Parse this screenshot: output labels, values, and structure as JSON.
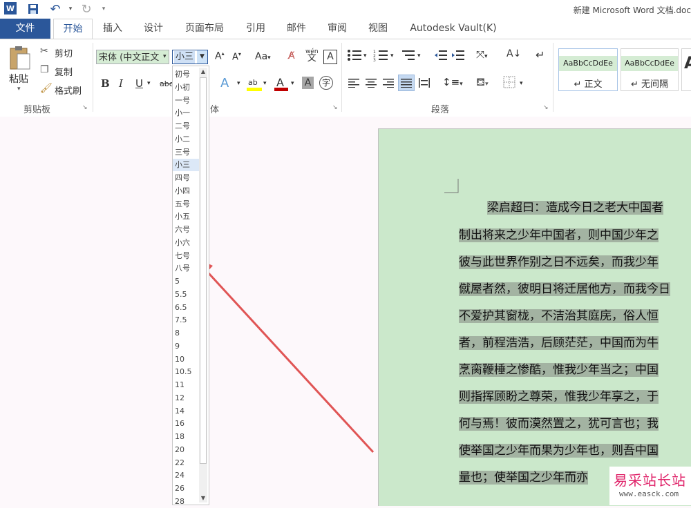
{
  "titlebar": {
    "doc_title": "新建 Microsoft Word 文档.doc"
  },
  "tabs": [
    {
      "label": "文件"
    },
    {
      "label": "开始"
    },
    {
      "label": "插入"
    },
    {
      "label": "设计"
    },
    {
      "label": "页面布局"
    },
    {
      "label": "引用"
    },
    {
      "label": "邮件"
    },
    {
      "label": "审阅"
    },
    {
      "label": "视图"
    },
    {
      "label": "Autodesk Vault(K)"
    }
  ],
  "clipboard": {
    "paste": "粘贴",
    "cut": "剪切",
    "copy": "复制",
    "format_painter": "格式刷",
    "group_label": "剪贴板"
  },
  "font": {
    "name": "宋体 (中文正文",
    "size": "小三",
    "group_label": "体",
    "aa": "Aa",
    "wen": "wén",
    "wen_char": "文",
    "A": "A"
  },
  "paragraph": {
    "group_label": "段落"
  },
  "styles": [
    {
      "sample": "AaBbCcDdEe",
      "name": "↵ 正文"
    },
    {
      "sample": "AaBbCcDdEe",
      "name": "↵ 无间隔"
    },
    {
      "sample": "A",
      "name": ""
    }
  ],
  "size_options": [
    "初号",
    "小初",
    "一号",
    "小一",
    "二号",
    "小二",
    "三号",
    "小三",
    "四号",
    "小四",
    "五号",
    "小五",
    "六号",
    "小六",
    "七号",
    "八号",
    "5",
    "5.5",
    "6.5",
    "7.5",
    "8",
    "9",
    "10",
    "10.5",
    "11",
    "12",
    "14",
    "16",
    "18",
    "20",
    "22",
    "24",
    "26",
    "28"
  ],
  "selected_size_index": 7,
  "document": {
    "lines": [
      "梁启超曰：造成今日之老大中国者",
      "制出将来之少年中国者，则中国少年之",
      "彼与此世界作别之日不远矣，而我少年",
      "僦屋者然，彼明日将迁居他方，而我今日",
      "不爱护其窗栊，不洁治其庭庑，俗人恒",
      "者，前程浩浩，后顾茫茫，中国而为牛",
      "烹脔鞭棰之惨酷，惟我少年当之；中国",
      "则指挥顾盼之尊荣，惟我少年享之，于",
      "何与焉！彼而漠然置之，犹可言也；我",
      "使举国之少年而果为少年也，则吾中国",
      "量也；使举国之少年而亦"
    ]
  },
  "watermark": {
    "main": "易采站长站",
    "url": "www.easck.com"
  }
}
